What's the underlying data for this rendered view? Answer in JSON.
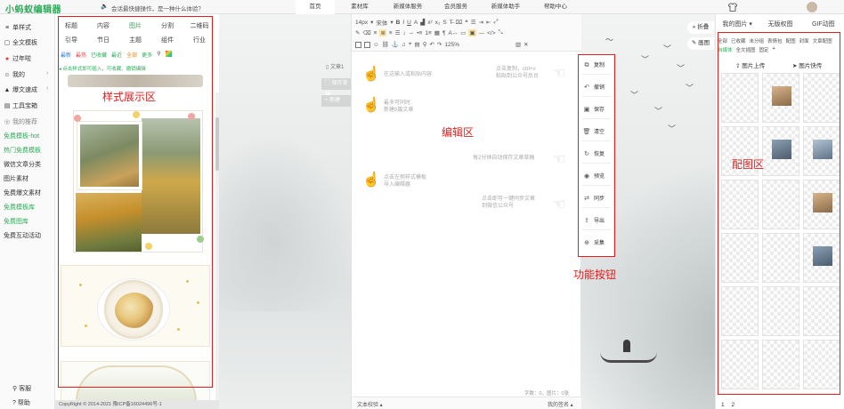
{
  "app": {
    "logo": "小蚂蚁编辑器",
    "notice": "会话最快捷操作，是一种什么体验？"
  },
  "topnav": [
    "首页",
    "素材库",
    "新媒体服务",
    "会员服务",
    "新媒体助手",
    "帮助中心"
  ],
  "sidebar": {
    "items": [
      {
        "icon": "≡",
        "label": "单样式"
      },
      {
        "icon": "▢",
        "label": "全文模板"
      },
      {
        "icon": "●",
        "label": "过年啦"
      },
      {
        "icon": "☺",
        "label": "我的"
      },
      {
        "icon": "▲",
        "label": "爆文速成"
      },
      {
        "icon": "▤",
        "label": "工具宝箱"
      },
      {
        "icon": "◎",
        "label": "我的推荐"
      }
    ],
    "links": [
      "免费模板-hot",
      "热门免费模板",
      "微信文章分类",
      "图片素材",
      "免费爆文素材",
      "免费模板库",
      "免费图库",
      "免费互动活动"
    ],
    "bottom": [
      {
        "icon": "⚲",
        "label": "客服"
      },
      {
        "icon": "?",
        "label": "帮助"
      }
    ]
  },
  "style_panel": {
    "row1": [
      "标题",
      "内容",
      "图片",
      "分割",
      "二维码"
    ],
    "row2": [
      "引导",
      "节日",
      "主题",
      "组件",
      "行业"
    ],
    "filters": [
      "最新",
      "最热",
      "已收藏",
      "最近",
      "全部",
      "更多"
    ],
    "hint": "点击样式即可插入，可收藏、撤销编辑",
    "region_label": "样式展示区",
    "copyright": "CopyRight © 2014-2021 豫ICP备16024496号-1"
  },
  "middle": {
    "article_tag": "文章1",
    "buttons": [
      "保存草稿",
      "新建"
    ]
  },
  "editor": {
    "toolbar": {
      "font_size": "14px",
      "font_family": "宋体",
      "row3": [
        "125%"
      ]
    },
    "hints": [
      {
        "text": "在这输入或粘贴内容"
      },
      {
        "text": "点击复制，ctrl+v\n粘贴到公众号后台"
      },
      {
        "text": "最多可同时\n新建8篇文章"
      },
      {
        "text": "每2分钟自动保存文章草稿"
      },
      {
        "text": "点击左侧样式模板\n导入编辑器"
      },
      {
        "text": "点击即可一键同步文章\n到微信公众号"
      }
    ],
    "region_label": "编辑区",
    "footer": {
      "word_count": "字数：0，图片：0张",
      "left_btn": "文本校验",
      "right_btn": "我的签名"
    }
  },
  "func_buttons": {
    "items": [
      {
        "icon": "⧉",
        "label": "复制"
      },
      {
        "icon": "↶",
        "label": "撤销"
      },
      {
        "icon": "▣",
        "label": "保存"
      },
      {
        "icon": "🗑",
        "label": "清空"
      },
      {
        "icon": "↻",
        "label": "恢复"
      },
      {
        "icon": "◉",
        "label": "预览"
      },
      {
        "icon": "⇄",
        "label": "同步"
      },
      {
        "icon": "⇪",
        "label": "导出"
      },
      {
        "icon": "⊕",
        "label": "采集"
      }
    ],
    "region_label": "功能按钮"
  },
  "image_panel": {
    "side_tabs": [
      "折叠",
      "画图"
    ],
    "tabs": [
      "我的图片",
      "无版权图",
      "GIF动图"
    ],
    "filters": [
      "全部",
      "已收藏",
      "未分组",
      "表情包",
      "配图",
      "封面",
      "文章配图",
      "自媒体",
      "全文插图",
      "固定",
      "+"
    ],
    "upload": "图片上传",
    "quick": "图片快传",
    "region_label": "配图区",
    "pages": [
      "1",
      "2"
    ]
  }
}
